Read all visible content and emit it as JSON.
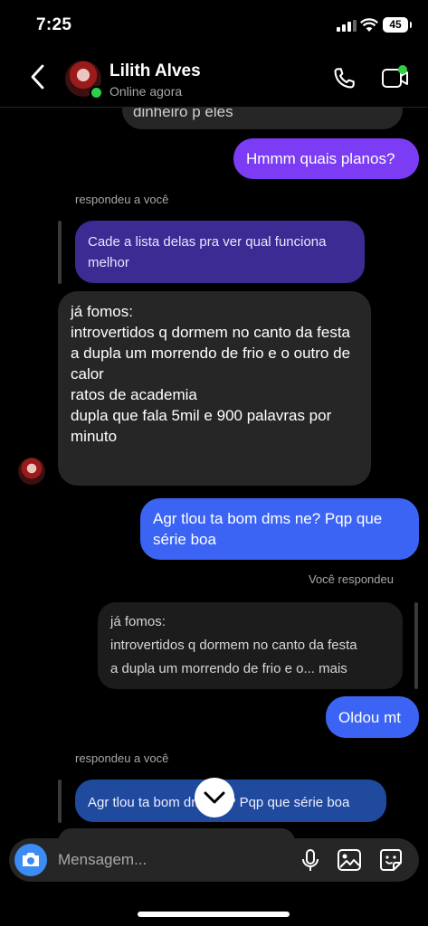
{
  "status_bar": {
    "time": "7:25",
    "battery": "45"
  },
  "header": {
    "contact_name": "Lilith Alves",
    "contact_status": "Online agora"
  },
  "messages": [
    {
      "id": "m0",
      "type": "incoming",
      "text": "dinheiro p eles"
    },
    {
      "id": "m1",
      "type": "outgoing",
      "text": "Hmmm quais planos?"
    },
    {
      "id": "m2",
      "type": "replied-label",
      "text": "respondeu a você"
    },
    {
      "id": "m3",
      "type": "quoted",
      "text": "Cade a lista delas pra ver qual funciona melhor"
    },
    {
      "id": "m4",
      "type": "incoming",
      "lines": [
        "já fomos:",
        "introvertidos q dormem no canto da festa",
        "a dupla um morrendo de frio e o outro de calor",
        "ratos de academia",
        "dupla que fala 5mil e 900 palavras por minuto"
      ]
    },
    {
      "id": "m5",
      "type": "outgoing",
      "text": "Agr tlou ta bom dms ne? Pqp que série boa"
    },
    {
      "id": "m6",
      "type": "replied-label",
      "text": "Você respondeu"
    },
    {
      "id": "m7",
      "type": "quoted",
      "lines": [
        "já fomos:",
        "introvertidos q dormem no canto da festa",
        "a dupla um morrendo de frio e o... mais"
      ]
    },
    {
      "id": "m8",
      "type": "outgoing",
      "text": "Oldou mt"
    },
    {
      "id": "m9",
      "type": "replied-label",
      "text": "respondeu a você"
    },
    {
      "id": "m10",
      "type": "quoted",
      "text": "Agr tlou ta bom dms ne? Pqp que série boa"
    }
  ],
  "composer": {
    "placeholder": "Mensagem..."
  },
  "colors": {
    "purple": "#7b3cf3",
    "blue": "#3b64f5",
    "online": "#2ed046",
    "incoming": "#262626"
  },
  "icons": [
    "back-icon",
    "phone-icon",
    "video-call-icon",
    "camera-icon",
    "microphone-icon",
    "gallery-icon",
    "sticker-icon",
    "chevron-down-icon"
  ]
}
